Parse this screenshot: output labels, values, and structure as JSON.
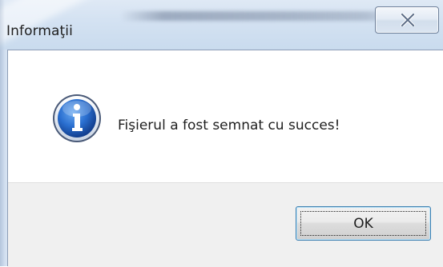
{
  "window": {
    "title": "Informaţii",
    "close_icon": "close-icon",
    "close_glyph": "✕"
  },
  "dialog": {
    "icon": "info-icon",
    "icon_glyph": "i",
    "message": "Fişierul a fost semnat cu succes!",
    "ok_label": "OK"
  },
  "colors": {
    "titlebar": "#d4e2f2",
    "footer": "#f0f0f0",
    "info_icon_blue": "#1f5fb8",
    "button_border": "#3c7fb1"
  }
}
